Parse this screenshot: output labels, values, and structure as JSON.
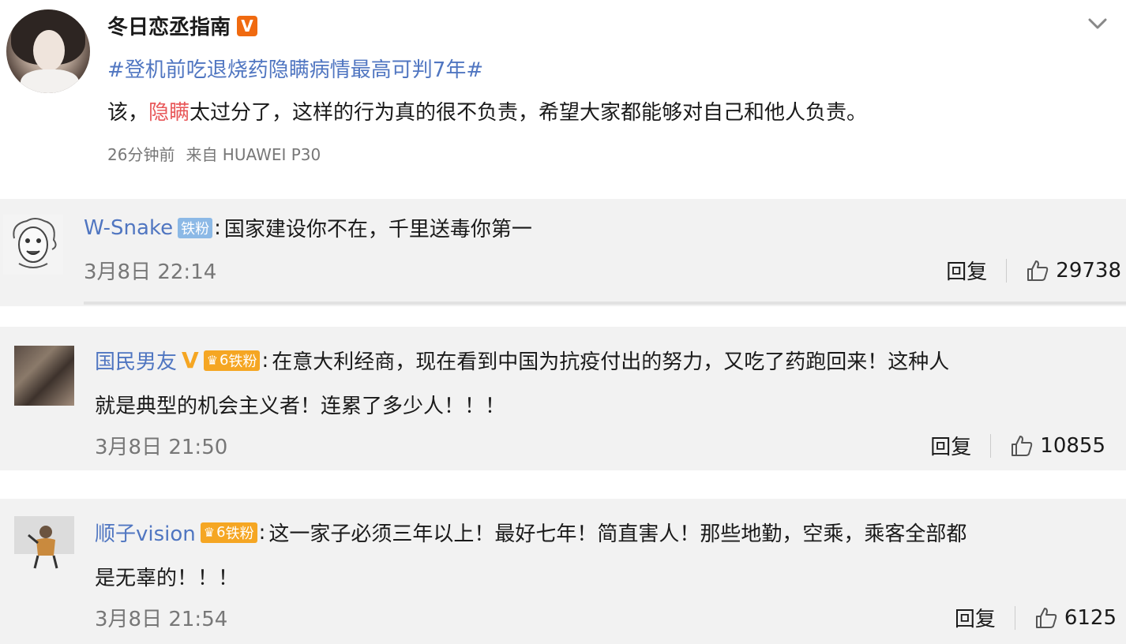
{
  "post": {
    "author": "冬日恋丞指南",
    "vip_badge": "V",
    "topic": "#登机前吃退烧药隐瞒病情最高可判7年#",
    "text_before": "该，",
    "text_highlight": "隐瞒",
    "text_after": "太过分了，这样的行为真的很不负责，希望大家都能够对自己和他人负责。",
    "time": "26分钟前",
    "source": "来自 HUAWEI P30"
  },
  "comments": [
    {
      "user": "W-Snake",
      "fan_badge": "铁粉",
      "text_line1": "国家建设你不在，千里送毒你第一",
      "text_line2": "",
      "time": "3月8日 22:14",
      "reply_label": "回复",
      "likes": "29738"
    },
    {
      "user": "国民男友",
      "verified": "V",
      "fan_badge": "铁粉",
      "fan_level": "6",
      "text_line1": "在意大利经商，现在看到中国为抗疫付出的努力，又吃了药跑回来！这种人",
      "text_line2": "就是典型的机会主义者！连累了多少人！！！",
      "time": "3月8日 21:50",
      "reply_label": "回复",
      "likes": "10855"
    },
    {
      "user": "顺子vision",
      "fan_badge": "铁粉",
      "fan_level": "6",
      "text_line1": "这一家子必须三年以上！最好七年！简直害人！那些地勤，空乘，乘客全部都",
      "text_line2": "是无辜的！！！",
      "time": "3月8日 21:54",
      "reply_label": "回复",
      "likes": "6125"
    }
  ],
  "icons": {
    "chevron": "chevron-down-icon",
    "like": "thumbs-up-icon"
  },
  "colors": {
    "link": "#5076c1",
    "highlight": "#e8585a",
    "vip_orange": "#f06a10",
    "fan_blue": "#8cb9e6",
    "fan_gold": "#f5a623",
    "comment_bg": "#f2f2f2"
  }
}
